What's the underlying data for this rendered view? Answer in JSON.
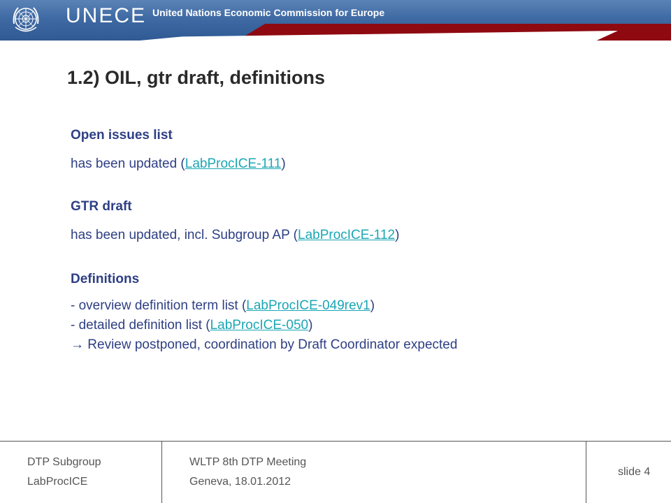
{
  "header": {
    "brand": "UNECE",
    "subtitle": "United Nations Economic Commission for Europe"
  },
  "title": "1.2) OIL, gtr draft, definitions",
  "sections": {
    "open_issues": {
      "heading": "Open issues list",
      "text_before": "has been updated (",
      "link": "LabProcICE-111",
      "text_after": ")"
    },
    "gtr_draft": {
      "heading": "GTR draft",
      "text_before": "has been updated, incl. Subgroup AP (",
      "link": "LabProcICE-112",
      "text_after": ")"
    },
    "definitions": {
      "heading": "Definitions",
      "line1_before": "- overview definition term list (",
      "line1_link": "LabProcICE-049rev1",
      "line1_after": ")",
      "line2_before": "- detailed definition list (",
      "line2_link": "LabProcICE-050",
      "line2_after": ")",
      "line3_arrow": "→",
      "line3_text": " Review postponed, coordination by Draft Coordinator expected"
    }
  },
  "footer": {
    "left_line1": "DTP Subgroup",
    "left_line2": "LabProcICE",
    "mid_line1": "WLTP 8th DTP Meeting",
    "mid_line2": "Geneva, 18.01.2012",
    "slide": "slide 4"
  },
  "colors": {
    "header_blue": "#3f6aa3",
    "header_red": "#8e0a10",
    "text_blue": "#2e3f84",
    "link": "#1aa7b5"
  },
  "icons": {
    "logo": "un-emblem-icon",
    "arrow": "arrow-right-icon"
  }
}
